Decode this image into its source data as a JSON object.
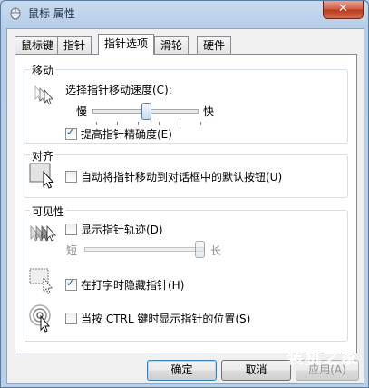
{
  "window": {
    "title": "鼠标 属性"
  },
  "tabs": [
    {
      "label": "鼠标键"
    },
    {
      "label": "指针"
    },
    {
      "label": "指针选项",
      "active": true
    },
    {
      "label": "滑轮"
    },
    {
      "label": "硬件"
    }
  ],
  "motion": {
    "title": "移动",
    "speed_label": "选择指针移动速度(C):",
    "slow_label": "慢",
    "fast_label": "快",
    "speed_level": 0.5,
    "precision_label": "提高指针精确度(E)",
    "precision_checked": true
  },
  "snap": {
    "title": "对齐",
    "label": "自动将指针移动到对话框中的默认按钮(U)",
    "checked": false
  },
  "visibility": {
    "title": "可见性",
    "trails_label": "显示指针轨迹(D)",
    "trails_checked": false,
    "short_label": "短",
    "long_label": "长",
    "trails_level": 1.0,
    "hide_label": "在打字时隐藏指针(H)",
    "hide_checked": true,
    "ctrl_label": "当按 CTRL 键时显示指针的位置(S)",
    "ctrl_checked": false
  },
  "buttons": {
    "ok": "确定",
    "cancel": "取消",
    "apply": "应用(A)"
  },
  "watermark": "装机之家",
  "colors": {
    "accent": "#3c7fb1",
    "close": "#c8472b",
    "group_border": "#d5dfe5"
  }
}
